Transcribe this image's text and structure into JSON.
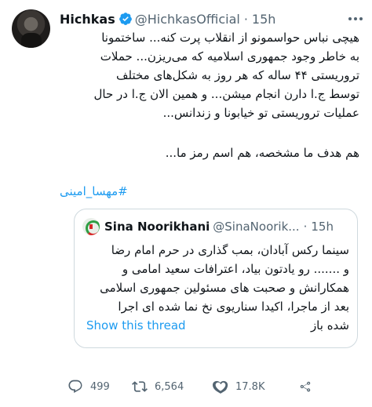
{
  "tweet": {
    "author_name": "Hichkas",
    "author_handle": "@HichkasOfficial",
    "separator": "·",
    "time": "15h",
    "text_part1": "هیچی نباس حواسمونو از انقلاب پرت کنه... ساختمونا\nبه خاطر وجود جمهوری اسلامیه که می‌ریزن... حملات\nتروریستی ۴۴ ساله که هر روز به شکل‌های مختلف\nتوسط ج.ا دارن انجام میشن... و همین الان ج.ا در حال\nعملیات تروریستی تو خیابونا و زندانس...",
    "text_part2": "هم هدف ما مشخصه، هم اسم رمز ما...",
    "hashtag": "#مهسا_امینی",
    "icons": {
      "verified": "verified-badge-icon",
      "more": "more-options-icon"
    },
    "colors": {
      "accent": "#1d9bf0",
      "secondary_text": "#536471",
      "border": "#cfd9de"
    }
  },
  "quote": {
    "author_name": "Sina Noorikhani",
    "author_handle": "@SinaNoorik...",
    "separator": "·",
    "time": "15h",
    "text": "سینما رکس آبادان، بمب گذاری در حرم امام رضا\nو ....... رو یادتون بیاد، اعترافات سعید امامی و\nهمکارانش و صحبت های مسئولین جمهوری اسلامی\nبعد از ماجرا، اکیدا سناریوی نخ نما شده ای اجرا\nشده باز",
    "show_thread": "Show this thread"
  },
  "actions": {
    "replies": "499",
    "retweets": "6,564",
    "likes": "17.8K",
    "icons": [
      "reply-icon",
      "retweet-icon",
      "like-icon",
      "share-icon"
    ]
  }
}
